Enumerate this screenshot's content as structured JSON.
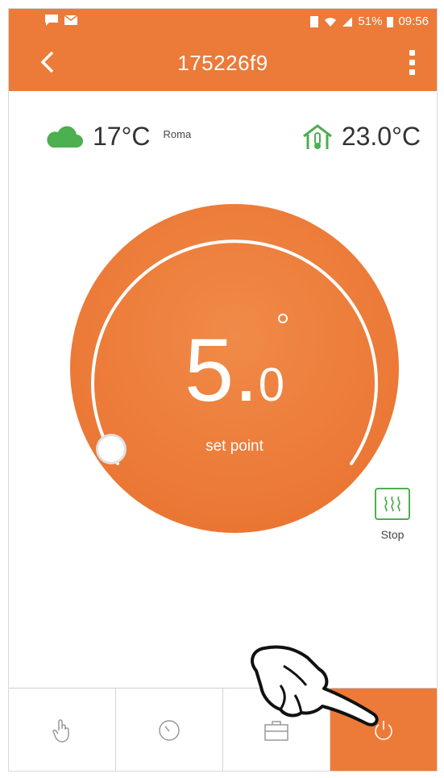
{
  "status_bar": {
    "battery": "51%",
    "time": "09:56"
  },
  "app_bar": {
    "title": "175226f9"
  },
  "weather": {
    "outdoor_temp": "17°C",
    "city": "Roma",
    "indoor_temp": "23.0°C"
  },
  "dial": {
    "setpoint_int": "5.",
    "setpoint_dec": "0",
    "label": "set point"
  },
  "stop": {
    "label": "Stop"
  },
  "nav": {
    "items": [
      {
        "icon": "hand-manual-icon"
      },
      {
        "icon": "clock-schedule-icon"
      },
      {
        "icon": "suitcase-holiday-icon"
      },
      {
        "icon": "power-icon",
        "active": true
      }
    ]
  },
  "colors": {
    "accent": "#ec7a38",
    "green": "#4caf50"
  }
}
